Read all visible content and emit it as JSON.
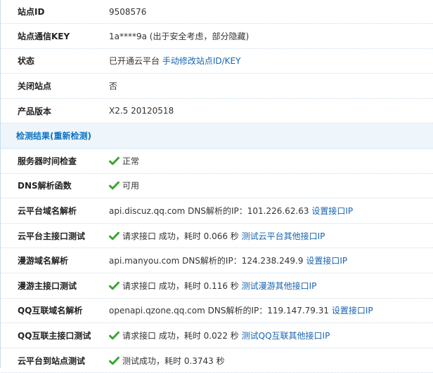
{
  "rows": [
    {
      "label": "站点ID",
      "value": "9508576"
    },
    {
      "label": "站点通信KEY",
      "value": "1a****9a (出于安全考虑，部分隐藏)"
    },
    {
      "label": "状态",
      "value": "已开通云平台",
      "link": "手动修改站点ID/KEY"
    },
    {
      "label": "关闭站点",
      "value": "否"
    },
    {
      "label": "产品版本",
      "value": "X2.5 20120518"
    }
  ],
  "section": {
    "title": "检测结果(",
    "recheck_label": "重新检测",
    "title_end": ")"
  },
  "checks": [
    {
      "label": "服务器时间检查",
      "text": "正常",
      "ok": true
    },
    {
      "label": "DNS解析函数",
      "text": "可用",
      "ok": true
    },
    {
      "label": "云平台域名解析",
      "text": "api.discuz.qq.com DNS解析的IP：101.226.62.63",
      "link": "设置接口IP",
      "ok": false
    },
    {
      "label": "云平台主接口测试",
      "text": "请求接口  成功，耗时  0.066 秒",
      "link": "测试云平台其他接口IP",
      "ok": true
    },
    {
      "label": "漫游域名解析",
      "text": "api.manyou.com DNS解析的IP：124.238.249.9",
      "link": "设置接口IP",
      "ok": false
    },
    {
      "label": "漫游主接口测试",
      "text": "请求接口  成功，耗时  0.116 秒",
      "link": "测试漫游其他接口IP",
      "ok": true
    },
    {
      "label": "QQ互联域名解析",
      "text": "openapi.qzone.qq.com DNS解析的IP：119.147.79.31",
      "link": "设置接口IP",
      "ok": false
    },
    {
      "label": "QQ互联主接口测试",
      "text": "请求接口  成功，耗时  0.022 秒",
      "link": "测试QQ互联其他接口IP",
      "ok": true
    },
    {
      "label": "云平台到站点测试",
      "text": "测试成功，耗时  0.3743 秒",
      "ok": true
    }
  ],
  "colors": {
    "link": "#1763b0",
    "section_title": "#0b72c4",
    "check": "#3aa82f"
  },
  "icons": {
    "check": "check-icon"
  }
}
